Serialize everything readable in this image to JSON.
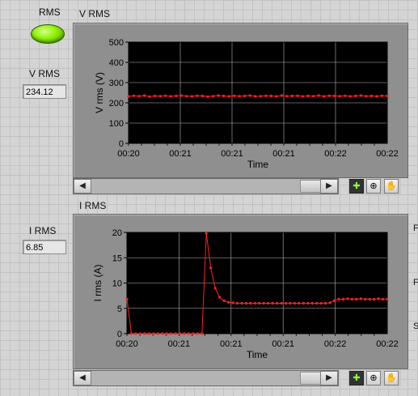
{
  "led": {
    "label": "RMS",
    "color": "#8cf000"
  },
  "indicators": {
    "vrms": {
      "label": "V RMS",
      "value": "234.12"
    },
    "irms": {
      "label": "I RMS",
      "value": "6.85"
    }
  },
  "colors": {
    "plot_bg": "#000000",
    "grid": "#b8b8b8",
    "trace": "#ff2020",
    "frame": "#8f8f8f"
  },
  "icons": [
    "scroll-left-icon",
    "scroll-right-icon",
    "cursor-tool-icon",
    "zoom-tool-icon",
    "pan-hand-icon"
  ],
  "right_edge_letters": [
    "F",
    "F",
    "S"
  ],
  "chart_data": [
    {
      "type": "line",
      "title": "V RMS",
      "xlabel": "Time",
      "ylabel": "V rms (V)",
      "ylim": [
        0,
        500
      ],
      "yticks": [
        "0",
        "100",
        "200",
        "300",
        "400",
        "500"
      ],
      "xticks": [
        "00:20",
        "00:21",
        "00:21",
        "00:21",
        "00:22",
        "00:22"
      ],
      "grid": true,
      "series": [
        {
          "values": [
            232,
            235,
            233,
            236,
            231,
            234,
            233,
            235,
            232,
            234,
            236,
            233,
            232,
            235,
            234,
            231,
            233,
            236,
            234,
            232,
            235,
            233,
            234,
            236,
            232,
            233,
            235,
            234,
            232,
            236,
            233,
            234,
            235,
            232,
            234,
            233,
            236,
            232,
            235,
            234,
            233,
            235,
            232,
            234,
            236,
            233,
            234,
            232,
            235,
            234
          ]
        }
      ]
    },
    {
      "type": "line",
      "title": "I RMS",
      "xlabel": "Time",
      "ylabel": "I rms  (A)",
      "ylim": [
        0,
        20
      ],
      "yticks": [
        "0",
        "5",
        "10",
        "15",
        "20"
      ],
      "xticks": [
        "00:20",
        "00:21",
        "00:21",
        "00:21",
        "00:22",
        "00:22"
      ],
      "grid": true,
      "series": [
        {
          "values": [
            6.8,
            0,
            0,
            0,
            0,
            0,
            0,
            0,
            0,
            0,
            0,
            0,
            0,
            0,
            0,
            0,
            0,
            0,
            19.8,
            13,
            9,
            7.2,
            6.5,
            6.2,
            6.1,
            6.0,
            6.0,
            6.0,
            6.0,
            6.0,
            6.0,
            6.0,
            6.0,
            6.0,
            6.0,
            6.0,
            6.0,
            6.0,
            6.0,
            6.0,
            6.0,
            6.0,
            6.0,
            6.0,
            6.0,
            6.0,
            6.1,
            6.5,
            6.8,
            6.8,
            6.9,
            6.8,
            6.8,
            6.9,
            6.8,
            6.8,
            6.8,
            6.9,
            6.8,
            6.8
          ]
        }
      ]
    }
  ]
}
